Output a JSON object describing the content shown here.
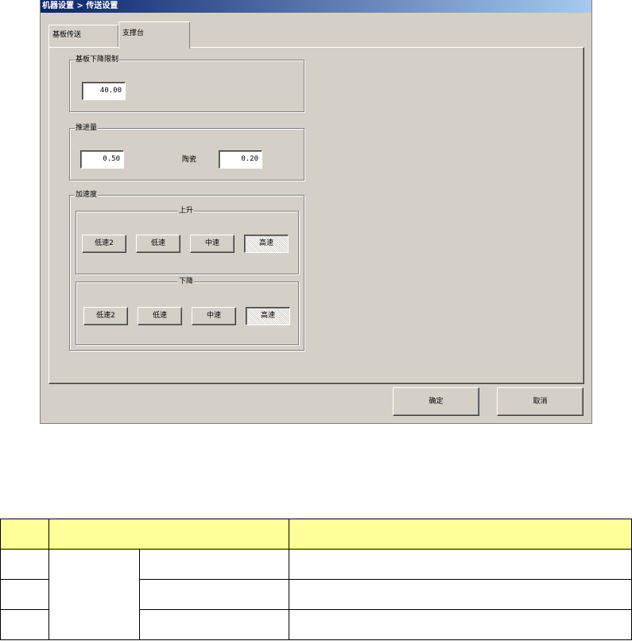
{
  "window": {
    "title": "机器设置 > 传送设置"
  },
  "tabs": [
    {
      "label": "基板传送",
      "active": false
    },
    {
      "label": "支撑台",
      "active": true
    }
  ],
  "lower_limit": {
    "label": "基板下降限制",
    "value": "40.00"
  },
  "push": {
    "label": "推进量",
    "value": "0.50",
    "ceramic_label": "陶瓷",
    "ceramic_value": "0.20"
  },
  "accel": {
    "label": "加速度",
    "up": {
      "label": "上升",
      "buttons": [
        "低速2",
        "低速",
        "中速",
        "高速"
      ],
      "selected": "高速"
    },
    "down": {
      "label": "下降",
      "buttons": [
        "低速2",
        "低速",
        "中速",
        "高速"
      ],
      "selected": "高速"
    }
  },
  "footer": {
    "ok": "确定",
    "cancel": "取消"
  },
  "table": {
    "header": [
      "",
      "",
      ""
    ],
    "rows": 3
  }
}
